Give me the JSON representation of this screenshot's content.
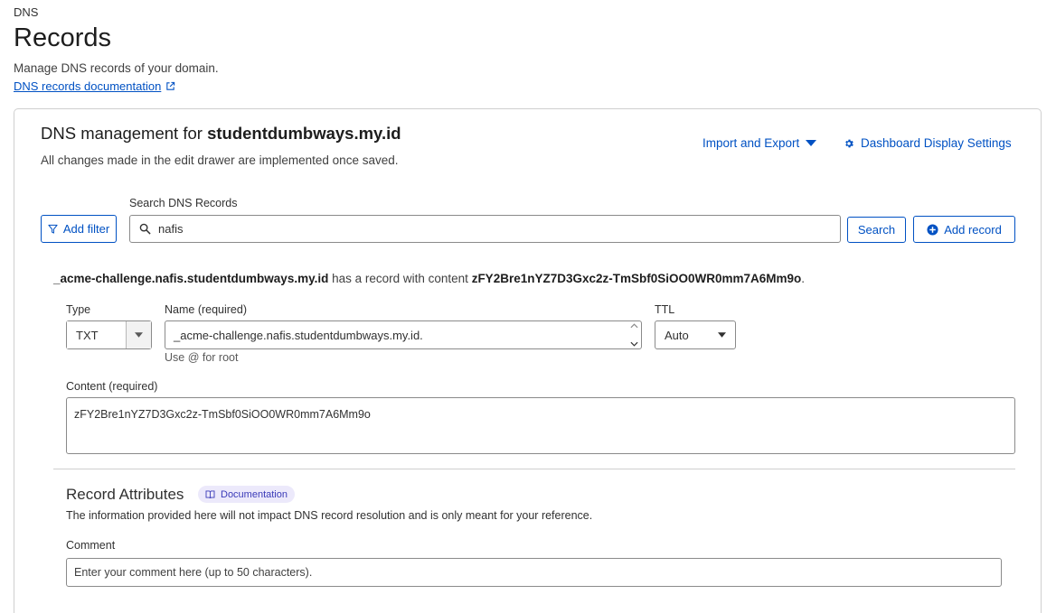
{
  "header": {
    "breadcrumb": "DNS",
    "title": "Records",
    "subtitle": "Manage DNS records of your domain.",
    "doc_link": "DNS records documentation"
  },
  "management": {
    "title_prefix": "DNS management for ",
    "domain": "studentdumbways.my.id",
    "subtitle": "All changes made in the edit drawer are implemented once saved.",
    "import_export_label": "Import and Export",
    "dashboard_settings_label": "Dashboard Display Settings"
  },
  "search": {
    "label": "Search DNS Records",
    "value": "nafis",
    "button_label": "Search",
    "add_filter_label": "Add filter",
    "add_record_label": "Add record"
  },
  "record": {
    "desc_name": "_acme-challenge.nafis.studentdumbways.my.id",
    "desc_middle": " has a record with content ",
    "desc_content": "zFY2Bre1nYZ7D3Gxc2z-TmSbf0SiOO0WR0mm7A6Mm9o",
    "desc_end": ".",
    "type_label": "Type",
    "type_value": "TXT",
    "name_label": "Name (required)",
    "name_value": "_acme-challenge.nafis.studentdumbways.my.id.",
    "name_hint": "Use @ for root",
    "ttl_label": "TTL",
    "ttl_value": "Auto",
    "content_label": "Content (required)",
    "content_value": "zFY2Bre1nYZ7D3Gxc2z-TmSbf0SiOO0WR0mm7A6Mm9o"
  },
  "attributes": {
    "title": "Record Attributes",
    "doc_pill": "Documentation",
    "subtitle": "The information provided here will not impact DNS record resolution and is only meant for your reference.",
    "comment_label": "Comment",
    "comment_placeholder": "Enter your comment here (up to 50 characters)."
  },
  "colors": {
    "accent": "#0051c3",
    "pill_bg": "#ece9fb",
    "border": "#8a8a8a"
  },
  "icons": [
    "external-link-icon",
    "caret-down-icon",
    "gear-icon",
    "filter-icon",
    "search-icon",
    "plus-circle-icon",
    "book-icon"
  ]
}
